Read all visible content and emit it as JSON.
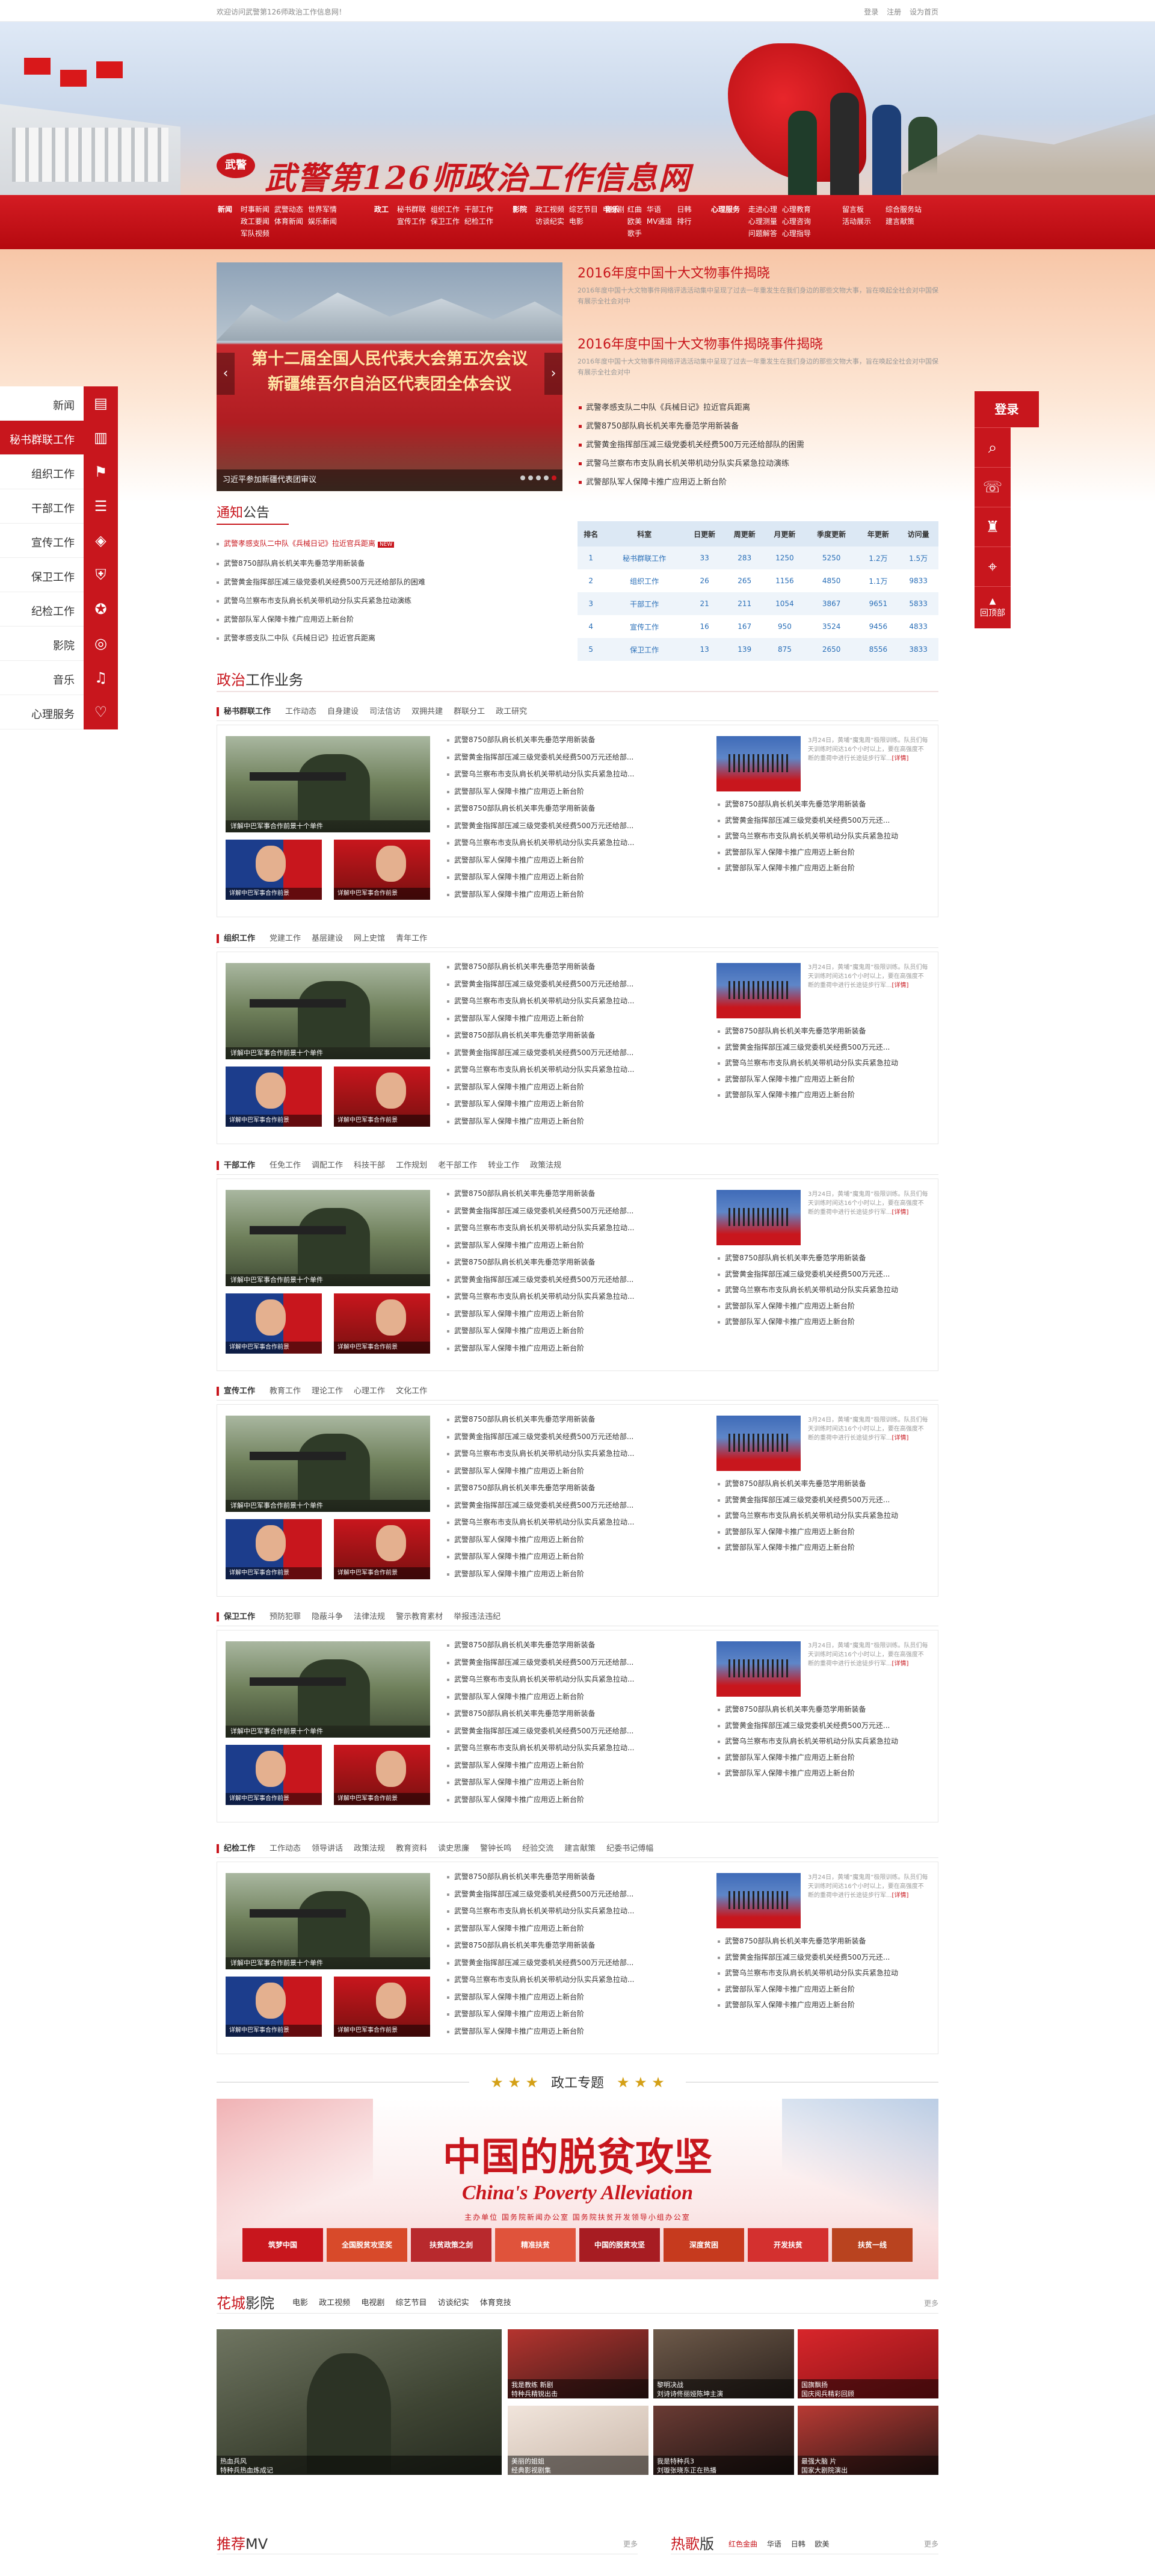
{
  "topbar": {
    "welcome": "欢迎访问武警第126师政治工作信息网！",
    "links": [
      "登录",
      "注册",
      "设为首页"
    ]
  },
  "header": {
    "site_title": "武警第126师政治工作信息网",
    "logo_text": "武警"
  },
  "nav": [
    {
      "head": "新闻",
      "items": [
        "时事新闻",
        "武警动态",
        "世界军情",
        "政工要闻",
        "体育新闻",
        "娱乐新闻",
        "军队视频"
      ]
    },
    {
      "head": "政工",
      "items": [
        "秘书群联",
        "组织工作",
        "干部工作",
        "宣传工作",
        "保卫工作",
        "纪检工作"
      ]
    },
    {
      "head": "影院",
      "items": [
        "政工视频",
        "综艺节目",
        "电视剧",
        "访谈纪实",
        "电影"
      ]
    },
    {
      "head": "音乐",
      "items": [
        "红曲",
        "华语",
        "日韩",
        "欧美",
        "MV通道",
        "排行",
        "歌手"
      ]
    },
    {
      "head": "心理服务",
      "items": [
        "走进心理",
        "心理教育",
        "心理测量",
        "心理咨询",
        "问题解答",
        "心理指导"
      ]
    },
    {
      "head": "",
      "items": [
        "留言板",
        "综合服务站",
        "活动展示",
        "建言献策"
      ]
    }
  ],
  "slider": {
    "headline_line1": "第十二届全国人民代表大会第五次会议",
    "headline_line2": "新疆维吾尔自治区代表团全体会议",
    "caption": "习近平参加新疆代表团审议"
  },
  "headlines": [
    {
      "title": "2016年度中国十大文物事件揭晓",
      "summary": "2016年度中国十大文物事件网络评选活动集中呈现了过去一年重发生在我们身边的那些文物大事，旨在唤起全社会对中国保有展示全社会对中"
    },
    {
      "title": "2016年度中国十大文物事件揭晓事件揭晓",
      "summary": "2016年度中国十大文物事件网络评选活动集中呈现了过去一年重发生在我们身边的那些文物大事，旨在唤起全社会对中国保有展示全社会对中"
    }
  ],
  "top_news": [
    "武警孝感支队二中队《兵械日记》拉近官兵距离",
    "武警8750部队肩长机关率先垂范学用新装备",
    "武警黄金指挥部压减三级党委机关经费500万元还给部队的困需",
    "武警乌兰察布市支队肩长机关带机动分队实兵紧急拉动演练",
    "武警部队军人保障卡推广应用迈上新台阶"
  ],
  "notice": {
    "title_main": "通知",
    "title_rest": "公告",
    "new_badge": "NEW",
    "items": [
      "武警孝感支队二中队《兵械日记》拉近官兵距离",
      "武警8750部队肩长机关率先垂范学用新装备",
      "武警黄金指挥部压减三级党委机关经费500万元还给部队的困难",
      "武警乌兰察布市支队肩长机关带机动分队实兵紧急拉动演练",
      "武警部队军人保障卡推广应用迈上新台阶",
      "武警孝感支队二中队《兵械日记》拉近官兵距离"
    ]
  },
  "stats": {
    "headers": [
      "排名",
      "科室",
      "日更新",
      "周更新",
      "月更新",
      "季度更新",
      "年更新",
      "访问量"
    ],
    "rows": [
      [
        "1",
        "秘书群联工作",
        "33",
        "283",
        "1250",
        "5250",
        "1.2万",
        "1.5万"
      ],
      [
        "2",
        "组织工作",
        "26",
        "265",
        "1156",
        "4850",
        "1.1万",
        "9833"
      ],
      [
        "3",
        "干部工作",
        "21",
        "211",
        "1054",
        "3867",
        "9651",
        "5833"
      ],
      [
        "4",
        "宣传工作",
        "16",
        "167",
        "950",
        "3524",
        "9456",
        "4833"
      ],
      [
        "5",
        "保卫工作",
        "13",
        "139",
        "875",
        "2650",
        "8556",
        "3833"
      ]
    ]
  },
  "left_tabs": [
    {
      "label": "新闻",
      "icon": "newspaper-icon",
      "glyph": "▤"
    },
    {
      "label": "秘书群联工作",
      "icon": "document-icon",
      "glyph": "▥"
    },
    {
      "label": "组织工作",
      "icon": "flag-icon",
      "glyph": "⚑"
    },
    {
      "label": "干部工作",
      "icon": "clipboard-icon",
      "glyph": "☰"
    },
    {
      "label": "宣传工作",
      "icon": "layers-icon",
      "glyph": "◈"
    },
    {
      "label": "保卫工作",
      "icon": "shield-icon",
      "glyph": "⛨"
    },
    {
      "label": "纪检工作",
      "icon": "star-badge-icon",
      "glyph": "✪"
    },
    {
      "label": "影院",
      "icon": "film-reel-icon",
      "glyph": "◎"
    },
    {
      "label": "音乐",
      "icon": "music-note-icon",
      "glyph": "♫"
    },
    {
      "label": "心理服务",
      "icon": "heart-icon",
      "glyph": "♡"
    }
  ],
  "right_tabs": {
    "login": "登录",
    "icons": [
      {
        "name": "search-icon",
        "glyph": "⌕"
      },
      {
        "name": "chat-icon",
        "glyph": "☏"
      },
      {
        "name": "soldier-icon",
        "glyph": "♜"
      },
      {
        "name": "location-icon",
        "glyph": "⌖"
      }
    ],
    "back_top": "回顶部",
    "back_top_glyph": "▲"
  },
  "section": {
    "title_main": "政治",
    "title_rest": "工作业务"
  },
  "blocks": [
    {
      "name": "秘书群联工作",
      "tabs": [
        "工作动态",
        "自身建设",
        "司法信访",
        "双拥共建",
        "群联分工",
        "政工研究"
      ]
    },
    {
      "name": "组织工作",
      "tabs": [
        "党建工作",
        "基层建设",
        "网上史馆",
        "青年工作"
      ]
    },
    {
      "name": "干部工作",
      "tabs": [
        "任免工作",
        "调配工作",
        "科技干部",
        "工作规划",
        "老干部工作",
        "转业工作",
        "政策法规"
      ]
    },
    {
      "name": "宣传工作",
      "tabs": [
        "教育工作",
        "理论工作",
        "心理工作",
        "文化工作"
      ]
    },
    {
      "name": "保卫工作",
      "tabs": [
        "预防犯罪",
        "隐蔽斗争",
        "法律法规",
        "警示教育素材",
        "举报违法违纪"
      ]
    },
    {
      "name": "纪检工作",
      "tabs": [
        "工作动态",
        "领导讲话",
        "政策法规",
        "教育资料",
        "读史思廉",
        "警钟长鸣",
        "经验交流",
        "建言献策",
        "纪委书记傅幅"
      ]
    }
  ],
  "block_content": {
    "big_caption": "详解中巴军事合作前景十个单件",
    "small_caption_a": "详解中巴军事合作前景",
    "small_caption_b": "详解中巴军事合作前景",
    "list": [
      "武警8750部队肩长机关率先垂范学用新装备",
      "武警黄金指挥部压减三级党委机关经费500万元还给部...",
      "武警乌兰察布市支队肩长机关带机动分队实兵紧急拉动...",
      "武警部队军人保障卡推广应用迈上新台阶",
      "武警8750部队肩长机关率先垂范学用新装备",
      "武警黄金指挥部压减三级党委机关经费500万元还给部...",
      "武警乌兰察布市支队肩长机关带机动分队实兵紧急拉动...",
      "武警部队军人保障卡推广应用迈上新台阶",
      "武警部队军人保障卡推广应用迈上新台阶",
      "武警部队军人保障卡推广应用迈上新台阶"
    ],
    "feat_text": "3月24日，黄埔“魔鬼周”极限训练。队员们每天训练时间达16个小时以上，要在高强度不断的重荷中进行长途徒步行军...",
    "feat_more": "[详情]",
    "list2": [
      "武警8750部队肩长机关率先垂范学用新装备",
      "武警黄金指挥部压减三级党委机关经费500万元还...",
      "武警乌兰察布市支队肩长机关带机动分队实兵紧急拉动",
      "武警部队军人保障卡推广应用迈上新台阶",
      "武警部队军人保障卡推广应用迈上新台阶"
    ]
  },
  "zhuanti": {
    "title": "政工专题",
    "stars": "★ ★ ★"
  },
  "poverty": {
    "cn": "中国的脱贫攻坚",
    "en": "China's Poverty Alleviation",
    "sub": "主办单位  国务院新闻办公室  国务院扶贫开发领导小组办公室",
    "strip": [
      "筑梦中国",
      "全国脱贫攻坚奖",
      "扶贫政策之剑",
      "精准扶贫",
      "中国的脱贫攻坚",
      "深度贫困",
      "开发扶贫",
      "扶贫一线"
    ]
  },
  "movies": {
    "title_main": "花城",
    "title_rest": "影院",
    "tabs": [
      "电影",
      "政工视频",
      "电视剧",
      "综艺节目",
      "访谈纪实",
      "体育竞技"
    ],
    "more": "更多",
    "big_caption_1": "热血兵风",
    "big_caption_2": "特种兵热血炼成记",
    "cells": [
      {
        "c1": "我是教练 新剧",
        "c2": "特种兵精锐出击"
      },
      {
        "c1": "黎明决战",
        "c2": "刘诗诗佟丽娅陈坤主演"
      },
      {
        "c1": "国旗飘扬",
        "c2": "国庆阅兵精彩回顾"
      },
      {
        "c1": "美丽的姐姐",
        "c2": "经典影视剧集"
      },
      {
        "c1": "我是特种兵3",
        "c2": "刘璇张晓东正在热播"
      },
      {
        "c1": "最强大脑 片",
        "c2": "国家大剧院演出"
      }
    ]
  },
  "bottom": {
    "mv_title_main": "推荐",
    "mv_title_rest": "MV",
    "mv_more": "更多",
    "hot_title_main": "热歌",
    "hot_title_rest": "版",
    "hot_tabs": [
      "红色金曲",
      "华语",
      "日韩",
      "欧美"
    ],
    "hot_more": "更多"
  },
  "colors": {
    "brand_red": "#c8161d",
    "link_blue": "#2a6fb8"
  }
}
